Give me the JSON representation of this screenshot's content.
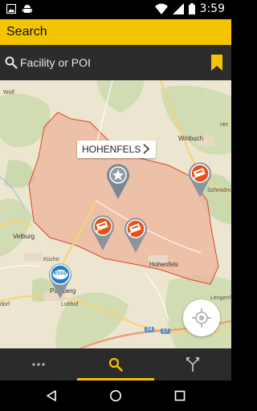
{
  "status_bar": {
    "time": "3:59"
  },
  "app_bar": {
    "title": "Search"
  },
  "search": {
    "placeholder": "Facility or POI"
  },
  "map": {
    "callout": {
      "label": "HOHENFELS"
    },
    "place_labels": [
      {
        "key": "wolf",
        "text": "Wolf"
      },
      {
        "key": "hohenfels",
        "text": "Hohenfels"
      },
      {
        "key": "winbuch",
        "text": "Winbuch"
      },
      {
        "key": "velburg",
        "text": "Velburg"
      },
      {
        "key": "parsberg",
        "text": "Parsberg"
      },
      {
        "key": "lohhof",
        "text": "Lohhof"
      },
      {
        "key": "schmidm",
        "text": "Schmidm"
      },
      {
        "key": "rier",
        "text": "rier"
      },
      {
        "key": "dorf",
        "text": "dorf"
      },
      {
        "key": "kuche",
        "text": "Küche"
      },
      {
        "key": "lengenf",
        "text": "Lengenf"
      }
    ],
    "route_badges": [
      "24",
      "17"
    ],
    "pins": [
      {
        "type": "selected-facility",
        "icon": "star-icon",
        "color": "#7a8794"
      },
      {
        "type": "facility",
        "icon": "flag-icon",
        "color": "#e65119"
      },
      {
        "type": "facility",
        "icon": "flag-icon",
        "color": "#e65119"
      },
      {
        "type": "facility",
        "icon": "flag-icon",
        "color": "#e65119"
      },
      {
        "type": "gas-station",
        "icon": "esso-logo",
        "color": "#1f7fc6",
        "text": "Esso"
      }
    ]
  },
  "bottom_nav": {
    "tabs": [
      "more-icon",
      "search-icon",
      "directions-icon"
    ],
    "active": "search-icon"
  },
  "colors": {
    "accent": "#f5c400",
    "area_fill": "#eeb097",
    "area_border": "#d8462f"
  }
}
